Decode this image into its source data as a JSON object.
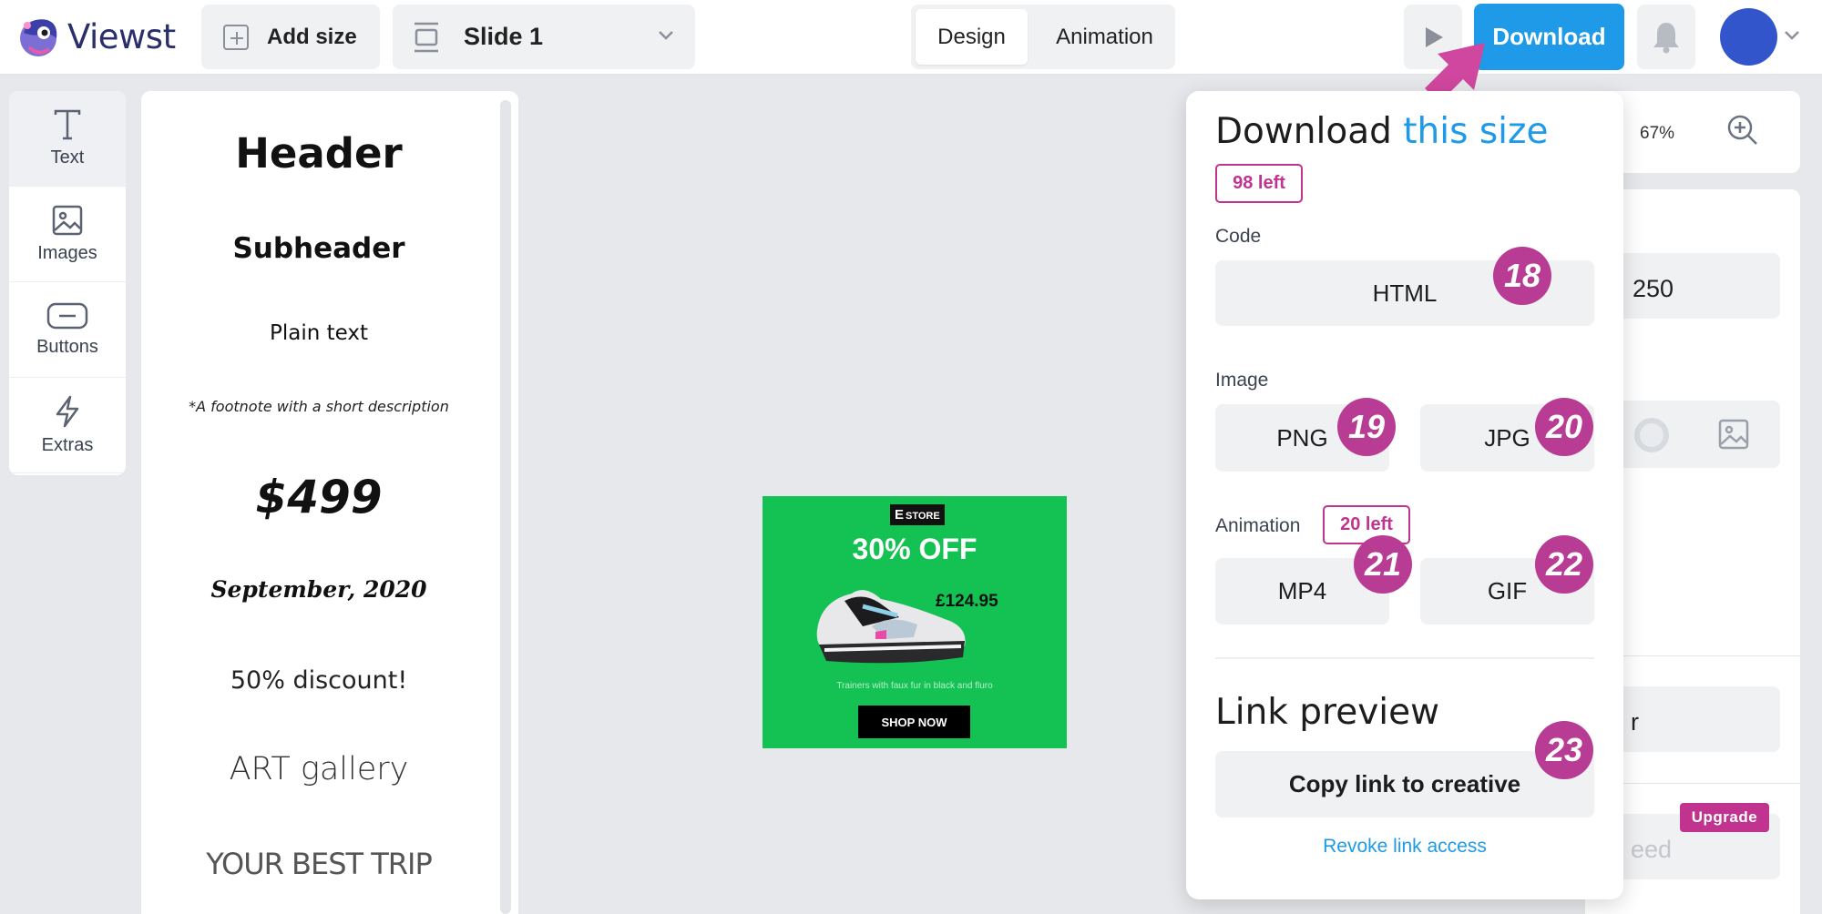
{
  "app": {
    "brand": "Viewst"
  },
  "toolbar": {
    "add_size_label": "Add size",
    "slide_label": "Slide 1",
    "tabs": [
      "Design",
      "Animation"
    ],
    "active_tab": "Design",
    "download_label": "Download"
  },
  "tools": [
    {
      "label": "Text",
      "icon": "text-icon",
      "active": true
    },
    {
      "label": "Images",
      "icon": "image-icon"
    },
    {
      "label": "Buttons",
      "icon": "button-icon"
    },
    {
      "label": "Extras",
      "icon": "bolt-icon"
    }
  ],
  "text_presets": {
    "header": "Header",
    "subheader": "Subheader",
    "plain": "Plain text",
    "footnote": "*A footnote with a short description",
    "price": "$499",
    "date": "September, 2020",
    "discount": "50% discount!",
    "art": "ART gallery",
    "trip": "YOUR BEST TRIP"
  },
  "banner": {
    "logo_e": "E",
    "logo_text": "STORE",
    "headline": "30% OFF",
    "price": "£124.95",
    "tagline": "Trainers with faux fur in black and fluro",
    "cta": "SHOP NOW"
  },
  "right_panel": {
    "zoom": "67%",
    "field_value": "250",
    "field_partial": "r",
    "field_placeholder_partial": "eed",
    "upgrade_label": "Upgrade"
  },
  "download_popup": {
    "title_main": "Download",
    "title_accent": "this size",
    "remaining": "98 left",
    "code_label": "Code",
    "html_label": "HTML",
    "image_label": "Image",
    "png_label": "PNG",
    "jpg_label": "JPG",
    "animation_label": "Animation",
    "animation_remaining": "20 left",
    "mp4_label": "MP4",
    "gif_label": "GIF",
    "link_title": "Link preview",
    "copy_link_label": "Copy link to creative",
    "revoke_label": "Revoke link access"
  },
  "callouts": [
    "18",
    "19",
    "20",
    "21",
    "22",
    "23"
  ],
  "colors": {
    "accent_blue": "#1e9ae8",
    "brand_magenta": "#c0338f",
    "banner_green": "#13c253",
    "avatar_blue": "#3355cc"
  }
}
